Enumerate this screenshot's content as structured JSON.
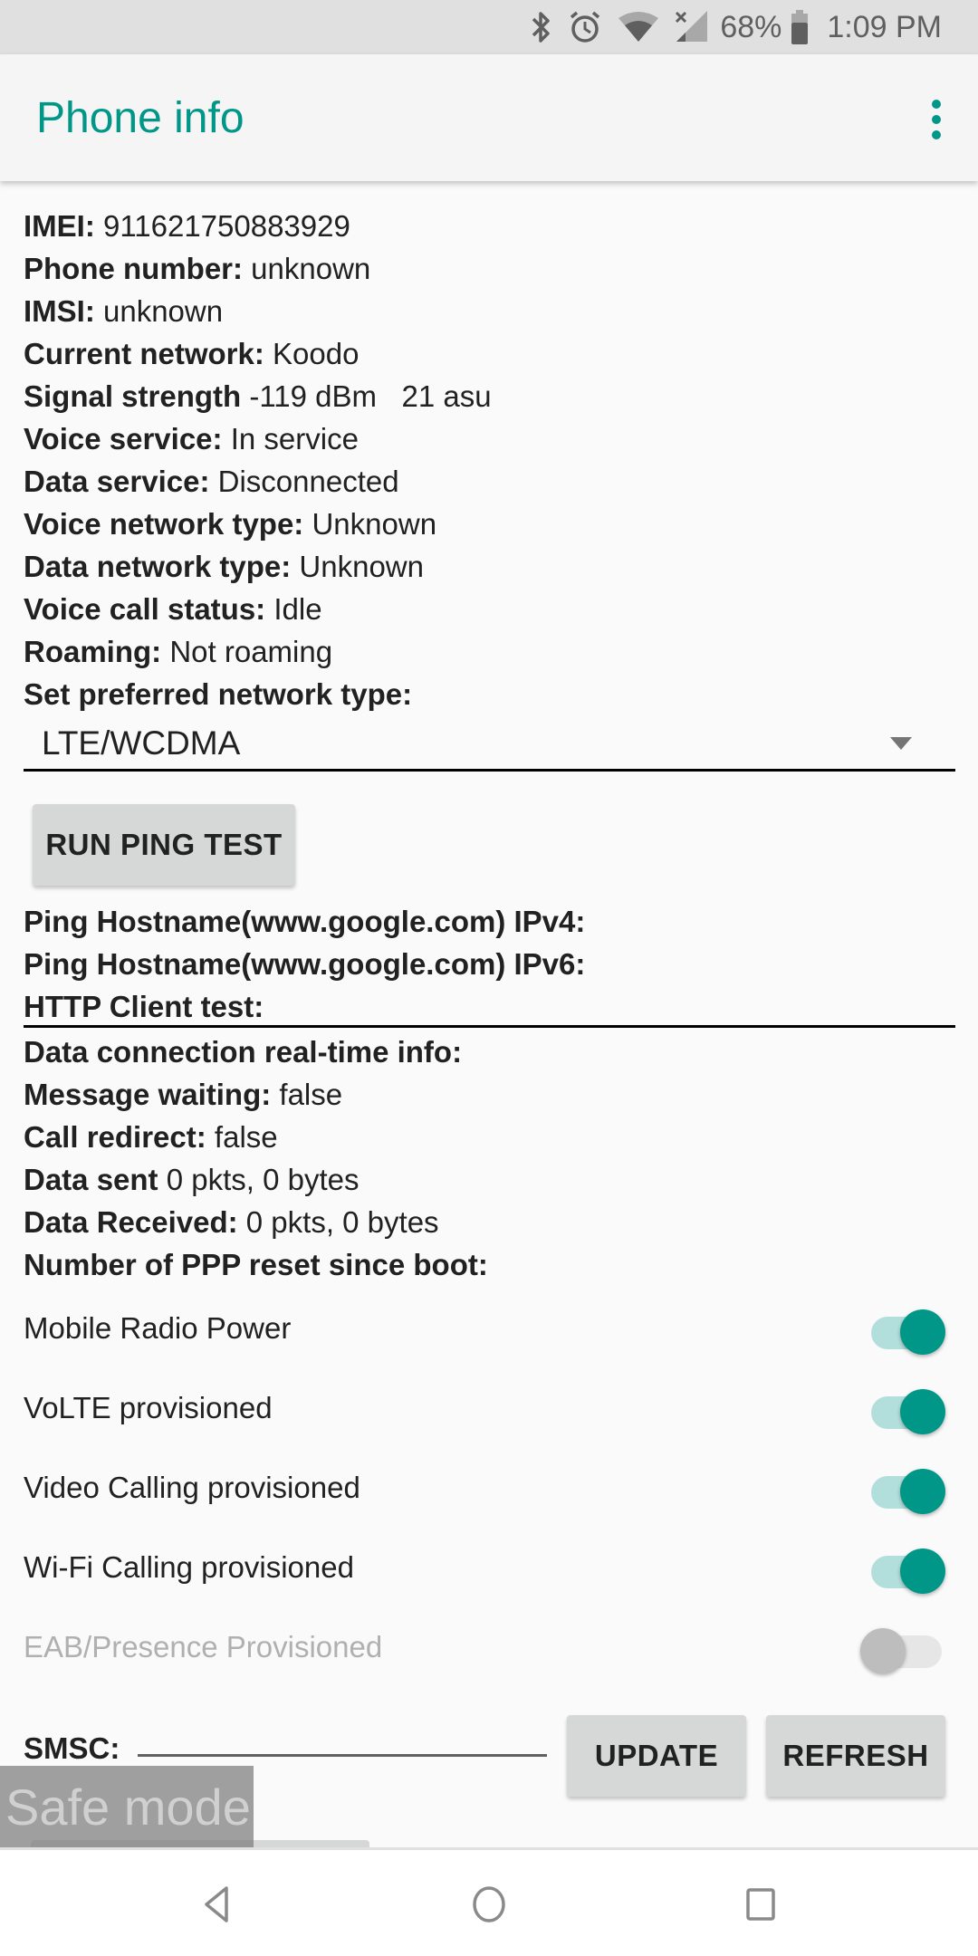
{
  "status_bar": {
    "battery_percent": "68%",
    "time": "1:09 PM",
    "icons": [
      "bluetooth-icon",
      "alarm-icon",
      "wifi-icon",
      "cell-signal-no-service-icon",
      "battery-icon"
    ]
  },
  "app_bar": {
    "title": "Phone info",
    "overflow_icon": "more-vert-icon"
  },
  "info": [
    {
      "label": "IMEI:",
      "value": " 911621750883929"
    },
    {
      "label": "Phone number:",
      "value": " unknown"
    },
    {
      "label": "IMSI:",
      "value": " unknown"
    },
    {
      "label": "Current network:",
      "value": " Koodo"
    },
    {
      "label": "Signal strength",
      "value": " -119 dBm   21 asu"
    },
    {
      "label": "Voice service:",
      "value": " In service"
    },
    {
      "label": "Data service:",
      "value": " Disconnected"
    },
    {
      "label": "Voice network type:",
      "value": " Unknown"
    },
    {
      "label": "Data network type:",
      "value": " Unknown"
    },
    {
      "label": "Voice call status:",
      "value": " Idle"
    },
    {
      "label": "Roaming:",
      "value": " Not roaming"
    },
    {
      "label": "Set preferred network type:",
      "value": ""
    }
  ],
  "preferred_network": {
    "selected": "LTE/WCDMA"
  },
  "ping_button": "RUN PING TEST",
  "ping_results": [
    {
      "label": "Ping Hostname(www.google.com) IPv4:",
      "value": ""
    },
    {
      "label": "Ping Hostname(www.google.com) IPv6:",
      "value": ""
    },
    {
      "label": "HTTP Client test:",
      "value": ""
    }
  ],
  "data_info": [
    {
      "label": "Data connection real-time info:",
      "value": ""
    },
    {
      "label": "Message waiting:",
      "value": " false"
    },
    {
      "label": "Call redirect:",
      "value": " false"
    },
    {
      "label": "Data sent",
      "value": " 0 pkts, 0 bytes"
    },
    {
      "label": "Data Received:",
      "value": " 0 pkts, 0 bytes"
    },
    {
      "label": "Number of PPP reset since boot:",
      "value": ""
    }
  ],
  "switches": [
    {
      "label": "Mobile Radio Power",
      "on": true,
      "enabled": true
    },
    {
      "label": "VoLTE provisioned",
      "on": true,
      "enabled": true
    },
    {
      "label": "Video Calling provisioned",
      "on": true,
      "enabled": true
    },
    {
      "label": "Wi-Fi Calling provisioned",
      "on": true,
      "enabled": true
    },
    {
      "label": "EAB/Presence Provisioned",
      "on": false,
      "enabled": false
    }
  ],
  "smsc": {
    "label": "SMSC:",
    "value": "",
    "update_button": "UPDATE",
    "refresh_button": "REFRESH"
  },
  "safe_mode_label": "Safe mode",
  "colors": {
    "accent": "#009688",
    "accent_light": "#b2dfdb",
    "status_bar_bg": "#e0e0e0",
    "button_bg": "#d6d7d7"
  }
}
